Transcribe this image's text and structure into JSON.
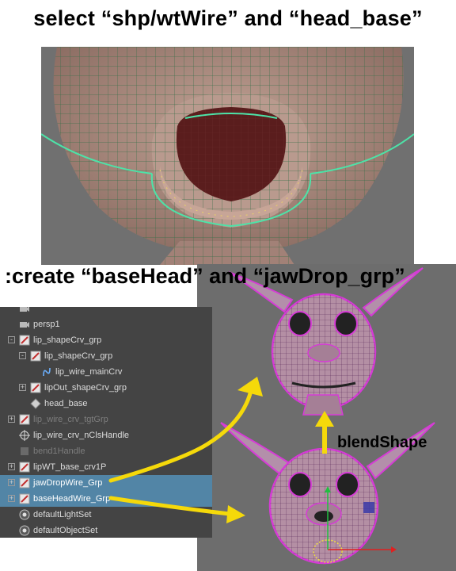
{
  "captions": {
    "top": "select “shp/wtWire” and “head_base”",
    "middle": ":create “baseHead” and “jawDrop_grp”"
  },
  "annotation": {
    "blend_label": "blendShape"
  },
  "outliner": {
    "items": [
      {
        "label": "",
        "icon": "camera-icon",
        "indent": 0,
        "expander": "",
        "dim": true,
        "selected": false
      },
      {
        "label": "persp1",
        "icon": "camera-icon",
        "indent": 0,
        "expander": "",
        "dim": false,
        "selected": false
      },
      {
        "label": "lip_shapeCrv_grp",
        "icon": "group-icon",
        "indent": 0,
        "expander": "-",
        "dim": false,
        "selected": false
      },
      {
        "label": "lip_shapeCrv_grp",
        "icon": "group-icon",
        "indent": 1,
        "expander": "-",
        "dim": false,
        "selected": false
      },
      {
        "label": "lip_wire_mainCrv",
        "icon": "curve-icon",
        "indent": 2,
        "expander": "",
        "dim": false,
        "selected": false
      },
      {
        "label": "lipOut_shapeCrv_grp",
        "icon": "group-icon",
        "indent": 1,
        "expander": "+",
        "dim": false,
        "selected": false
      },
      {
        "label": "head_base",
        "icon": "mesh-icon",
        "indent": 1,
        "expander": "",
        "dim": false,
        "selected": false
      },
      {
        "label": "lip_wire_crv_tgtGrp",
        "icon": "group-icon",
        "indent": 0,
        "expander": "+",
        "dim": true,
        "selected": false
      },
      {
        "label": "lip_wire_crv_nClsHandle",
        "icon": "cluster-icon",
        "indent": 0,
        "expander": "",
        "dim": false,
        "selected": false
      },
      {
        "label": "bend1Handle",
        "icon": "deformer-icon",
        "indent": 0,
        "expander": "",
        "dim": true,
        "selected": false
      },
      {
        "label": "lipWT_base_crv1P",
        "icon": "group-icon",
        "indent": 0,
        "expander": "+",
        "dim": false,
        "selected": false
      },
      {
        "label": "jawDropWire_Grp",
        "icon": "group-icon",
        "indent": 0,
        "expander": "+",
        "dim": false,
        "selected": true
      },
      {
        "label": "baseHeadWire_Grp",
        "icon": "group-icon",
        "indent": 0,
        "expander": "+",
        "dim": false,
        "selected": true
      },
      {
        "label": "defaultLightSet",
        "icon": "set-icon",
        "indent": 0,
        "expander": "",
        "dim": false,
        "selected": false
      },
      {
        "label": "defaultObjectSet",
        "icon": "set-icon",
        "indent": 0,
        "expander": "",
        "dim": false,
        "selected": false
      }
    ]
  },
  "colors": {
    "outliner_bg": "#444444",
    "selection": "#5285a6",
    "wireframe_select": "#d63bd6",
    "curve_green": "#4de3a8",
    "arrow_yellow": "#f5d90a",
    "mesh_skin": "#b08f84"
  }
}
